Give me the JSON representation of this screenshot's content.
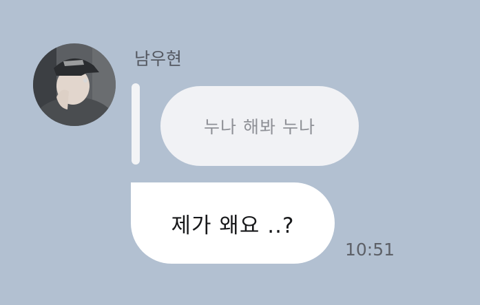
{
  "message": {
    "sender_name": "남우현",
    "quoted_text": "누나 해봐 누나",
    "text": "제가 왜요 ..?",
    "time": "10:51"
  },
  "colors": {
    "background": "#b2c0d1",
    "quoted_bubble": "#f1f2f5",
    "message_bubble": "#ffffff"
  },
  "icons": {
    "avatar": "profile-photo-avatar"
  }
}
